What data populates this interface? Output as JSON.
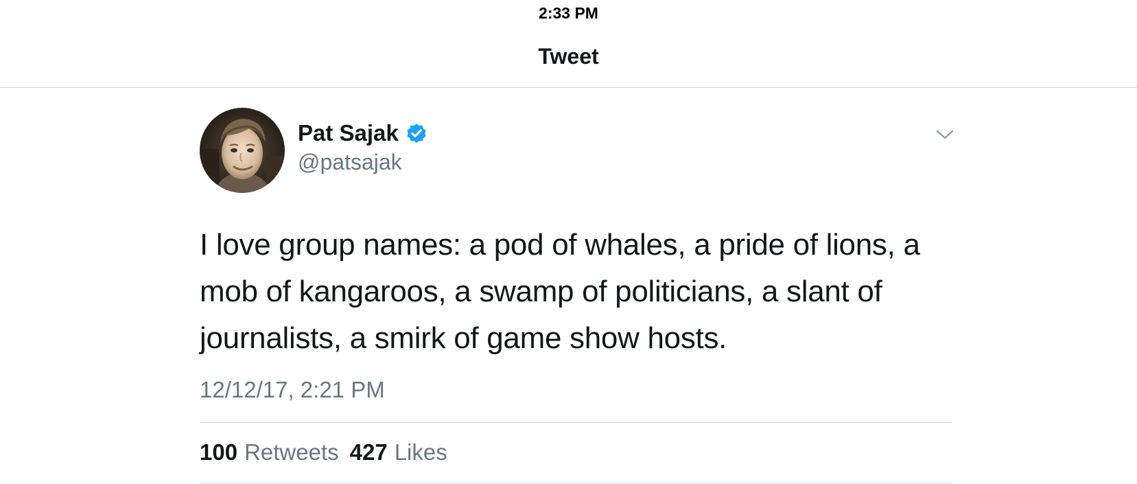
{
  "status_bar": {
    "time": "2:33 PM"
  },
  "nav": {
    "title": "Tweet"
  },
  "tweet": {
    "author": {
      "name": "Pat Sajak",
      "handle": "@patsajak",
      "verified": true,
      "avatar_icon": "avatar-photo"
    },
    "text": "I love group names: a pod of whales, a pride of lions, a mob of kangaroos, a swamp of politicians, a slant of journalists, a smirk of game show hosts.",
    "timestamp": "12/12/17, 2:21 PM",
    "stats": {
      "retweets_count": "100",
      "retweets_label": "Retweets",
      "likes_count": "427",
      "likes_label": "Likes"
    }
  },
  "icons": {
    "verified": "verified-badge-icon",
    "menu": "chevron-down-icon"
  },
  "colors": {
    "verified_blue": "#1da1f2",
    "text_primary": "#14171a",
    "text_secondary": "#657786",
    "divider": "#d0d5d9"
  }
}
